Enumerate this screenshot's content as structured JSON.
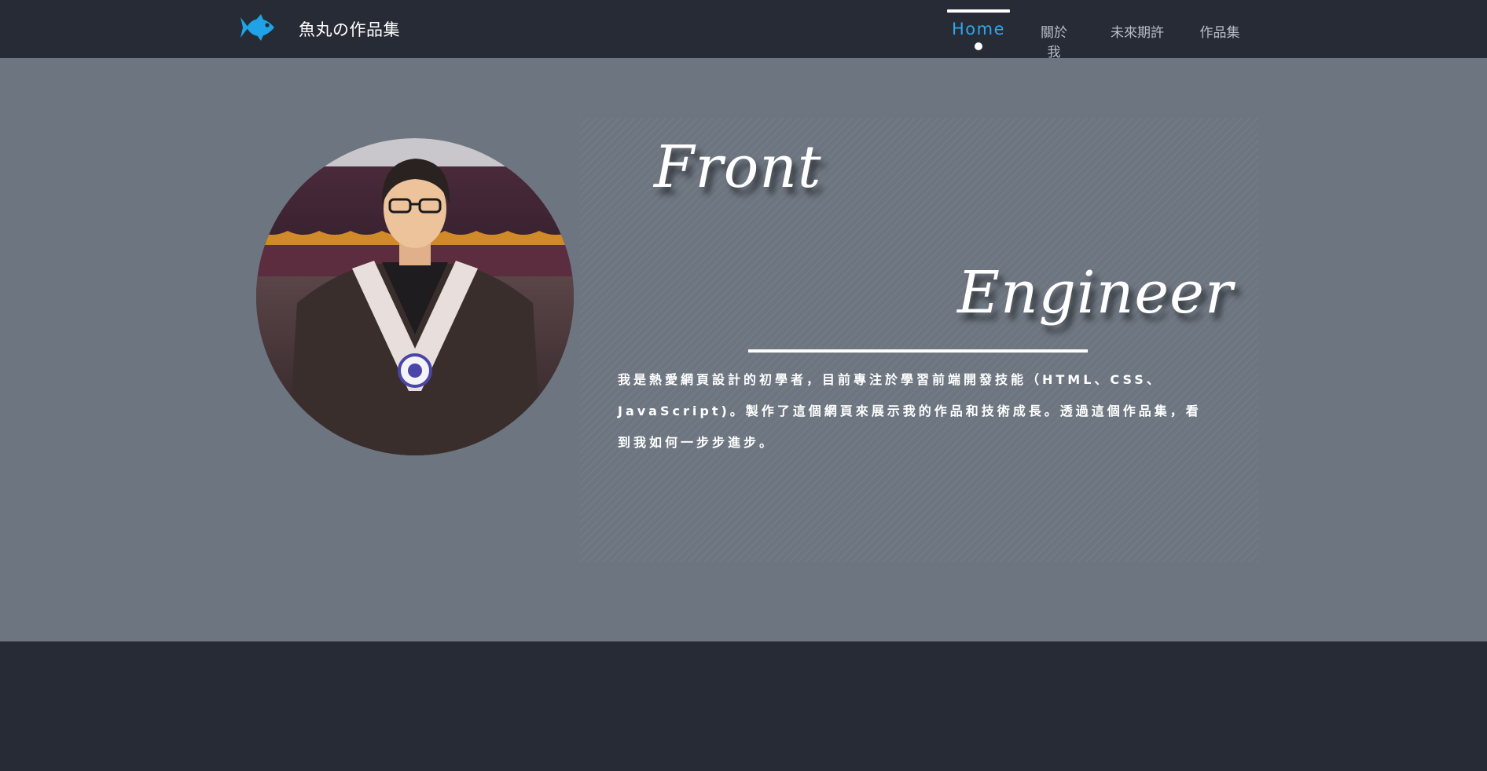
{
  "header": {
    "brand_icon": "fish-icon",
    "brand_color": "#1fa3e6",
    "title": "魚丸の作品集"
  },
  "nav": {
    "items": [
      {
        "label": "Home",
        "active": true
      },
      {
        "label": "關於我",
        "active": false
      },
      {
        "label": "未來期許",
        "active": false
      },
      {
        "label": "作品集",
        "active": false
      }
    ],
    "active_color": "#30a6e8"
  },
  "hero": {
    "photo_icon": "profile-photo",
    "heading_line1": "Front",
    "heading_line2": "Engineer",
    "intro": "我是熱愛網頁設計的初學者，目前專注於學習前端開發技能（HTML、CSS、JavaScript)。製作了這個網頁來展示我的作品和技術成長。透過這個作品集，看到我如何一步步進步。"
  },
  "colors": {
    "header_bg": "#262b35",
    "hero_bg": "#6d7580",
    "footer_bg": "#262b35"
  }
}
